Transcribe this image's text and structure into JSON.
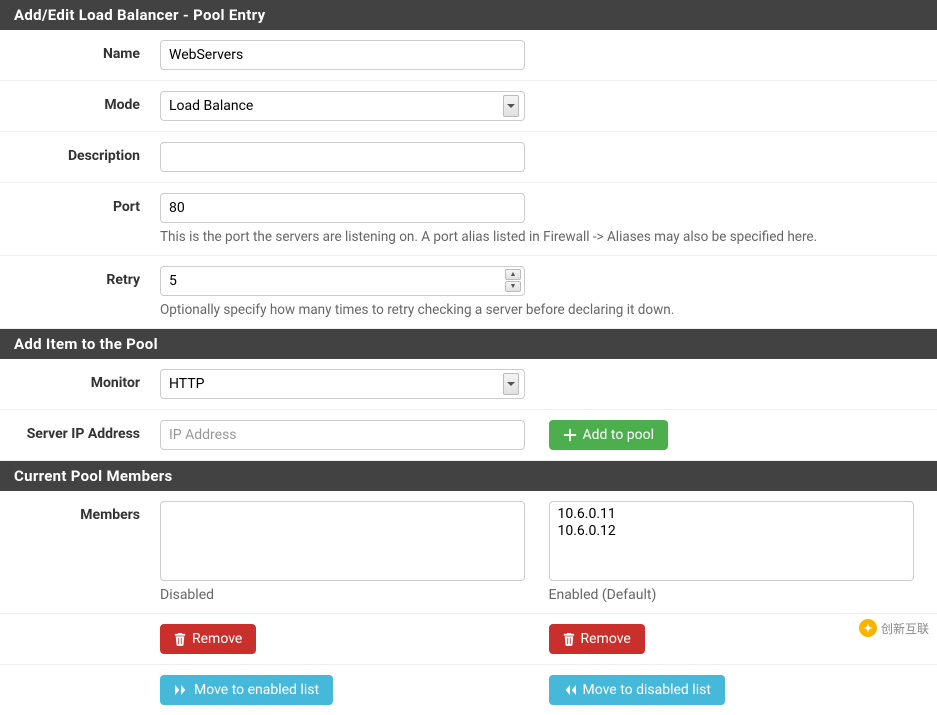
{
  "sections": {
    "edit": "Add/Edit Load Balancer - Pool Entry",
    "addItem": "Add Item to the Pool",
    "members": "Current Pool Members"
  },
  "labels": {
    "name": "Name",
    "mode": "Mode",
    "description": "Description",
    "port": "Port",
    "retry": "Retry",
    "monitor": "Monitor",
    "serverIp": "Server IP Address",
    "members": "Members"
  },
  "fields": {
    "name": "WebServers",
    "mode": "Load Balance",
    "description": "",
    "port": "80",
    "retry": "5",
    "monitor": "HTTP",
    "serverIpPlaceholder": "IP Address"
  },
  "help": {
    "port": "This is the port the servers are listening on. A port alias listed in Firewall -> Aliases may also be specified here.",
    "retry": "Optionally specify how many times to retry checking a server before declaring it down."
  },
  "buttons": {
    "addToPool": "Add to pool",
    "remove": "Remove",
    "moveEnabled": "Move to enabled list",
    "moveDisabled": "Move to disabled list"
  },
  "members": {
    "disabledLabel": "Disabled",
    "enabledLabel": "Enabled (Default)",
    "disabled": [],
    "enabled": [
      "10.6.0.11",
      "10.6.0.12"
    ]
  },
  "watermark": "创新互联"
}
